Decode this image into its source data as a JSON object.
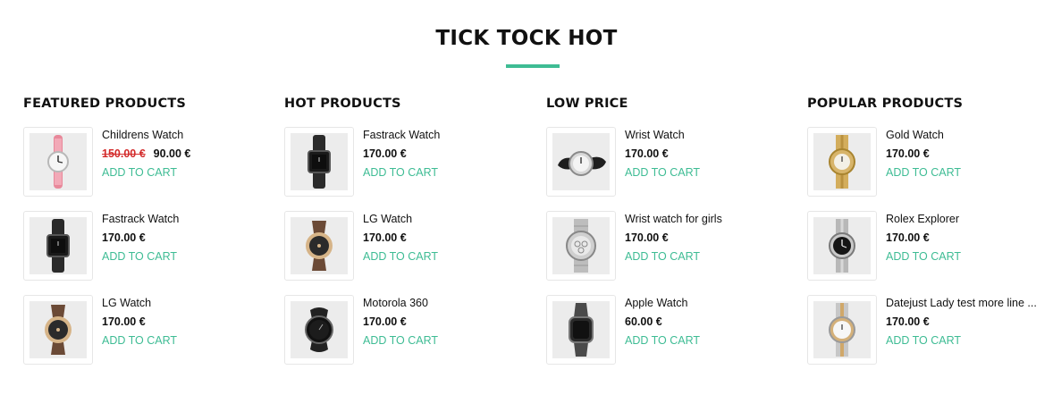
{
  "header": {
    "title": "TICK TOCK HOT"
  },
  "accent_color": "#3ebc94",
  "sale_color": "#d32b2b",
  "columns": [
    {
      "heading": "FEATURED PRODUCTS",
      "items": [
        {
          "name": "Childrens Watch",
          "old_price": "150.00 €",
          "price": "90.00 €",
          "cart": "ADD TO CART",
          "icon": "pink-strap-watch-icon"
        },
        {
          "name": "Fastrack Watch",
          "price": "170.00 €",
          "cart": "ADD TO CART",
          "icon": "black-square-watch-icon"
        },
        {
          "name": "LG Watch",
          "price": "170.00 €",
          "cart": "ADD TO CART",
          "icon": "gold-smartwatch-icon"
        }
      ]
    },
    {
      "heading": "HOT PRODUCTS",
      "items": [
        {
          "name": "Fastrack Watch",
          "price": "170.00 €",
          "cart": "ADD TO CART",
          "icon": "black-square-watch-icon"
        },
        {
          "name": "LG Watch",
          "price": "170.00 €",
          "cart": "ADD TO CART",
          "icon": "gold-smartwatch-icon"
        },
        {
          "name": "Motorola 360",
          "price": "170.00 €",
          "cart": "ADD TO CART",
          "icon": "black-round-smartwatch-icon"
        }
      ]
    },
    {
      "heading": "LOW PRICE",
      "items": [
        {
          "name": "Wrist Watch",
          "price": "170.00 €",
          "cart": "ADD TO CART",
          "icon": "silver-wrist-watch-icon"
        },
        {
          "name": "Wrist watch for girls",
          "price": "170.00 €",
          "cart": "ADD TO CART",
          "icon": "steel-chronograph-icon"
        },
        {
          "name": "Apple Watch",
          "price": "60.00 €",
          "cart": "ADD TO CART",
          "icon": "apple-watch-icon"
        }
      ]
    },
    {
      "heading": "POPULAR PRODUCTS",
      "items": [
        {
          "name": "Gold Watch",
          "price": "170.00 €",
          "cart": "ADD TO CART",
          "icon": "gold-watch-icon"
        },
        {
          "name": "Rolex Explorer",
          "price": "170.00 €",
          "cart": "ADD TO CART",
          "icon": "steel-black-dial-watch-icon"
        },
        {
          "name": "Datejust Lady test more line ...",
          "price": "170.00 €",
          "cart": "ADD TO CART",
          "icon": "two-tone-lady-watch-icon"
        }
      ]
    }
  ]
}
